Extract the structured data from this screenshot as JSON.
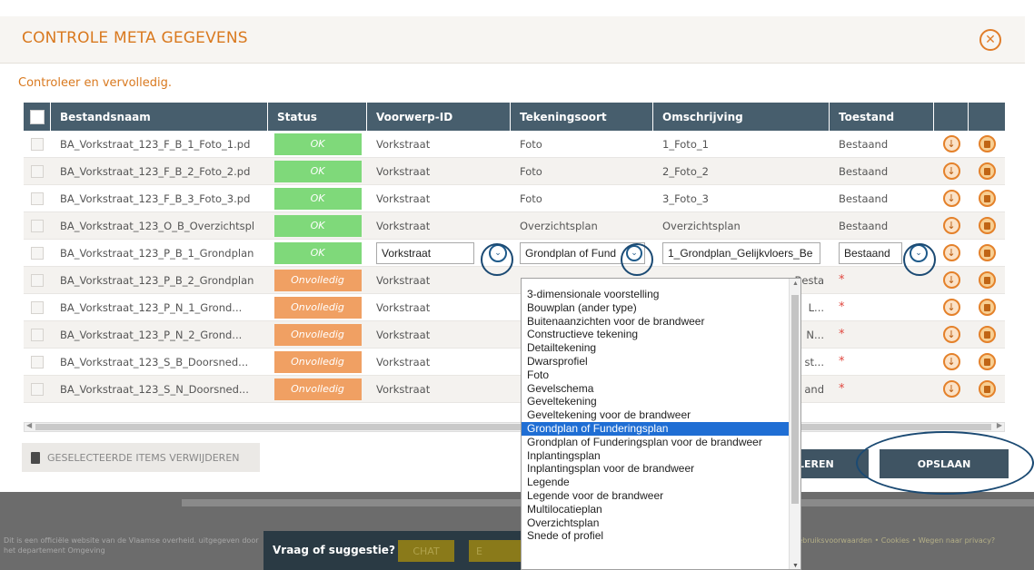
{
  "modal": {
    "title": "CONTROLE META GEGEVENS",
    "close_icon": "close-circle-icon",
    "subtitle": "Controleer en vervolledig."
  },
  "table": {
    "headers": [
      "Bestandsnaam",
      "Status",
      "Voorwerp-ID",
      "Tekeningsoort",
      "Omschrijving",
      "Toestand"
    ],
    "rows": [
      {
        "name": "BA_Vorkstraat_123_F_B_1_Foto_1.pd",
        "status": "OK",
        "vid": "Vorkstraat",
        "teken": "Foto",
        "oms": "1_Foto_1",
        "toe": "Bestaand"
      },
      {
        "name": "BA_Vorkstraat_123_F_B_2_Foto_2.pd",
        "status": "OK",
        "vid": "Vorkstraat",
        "teken": "Foto",
        "oms": "2_Foto_2",
        "toe": "Bestaand"
      },
      {
        "name": "BA_Vorkstraat_123_F_B_3_Foto_3.pd",
        "status": "OK",
        "vid": "Vorkstraat",
        "teken": "Foto",
        "oms": "3_Foto_3",
        "toe": "Bestaand"
      },
      {
        "name": "BA_Vorkstraat_123_O_B_Overzichtspl",
        "status": "OK",
        "vid": "Vorkstraat",
        "teken": "Overzichtsplan",
        "oms": "Overzichtsplan",
        "toe": "Bestaand"
      },
      {
        "name": "BA_Vorkstraat_123_P_B_1_Grondplan",
        "status": "OK",
        "vid": "Vorkstraat",
        "teken": "Grondplan of Fund",
        "oms": "1_Grondplan_Gelijkvloers_Be",
        "toe": "Bestaand"
      },
      {
        "name": "BA_Vorkstraat_123_P_B_2_Grondplan",
        "status": "Onvolledig",
        "vid": "Vorkstraat",
        "teken": "",
        "oms": "Besta",
        "toe": "*"
      },
      {
        "name": "BA_Vorkstraat_123_P_N_1_Grond...",
        "status": "Onvolledig",
        "vid": "Vorkstraat",
        "teken": "",
        "oms": "L...",
        "toe": "*"
      },
      {
        "name": "BA_Vorkstraat_123_P_N_2_Grond...",
        "status": "Onvolledig",
        "vid": "Vorkstraat",
        "teken": "",
        "oms": "N...",
        "toe": "*"
      },
      {
        "name": "BA_Vorkstraat_123_S_B_Doorsned...",
        "status": "Onvolledig",
        "vid": "Vorkstraat",
        "teken": "",
        "oms": "st...",
        "toe": "*"
      },
      {
        "name": "BA_Vorkstraat_123_S_N_Doorsned...",
        "status": "Onvolledig",
        "vid": "Vorkstraat",
        "teken": "",
        "oms": "and",
        "toe": "*"
      }
    ],
    "editing_row_index": 4,
    "row_icons": {
      "download": "download-icon",
      "delete": "trash-icon"
    }
  },
  "dropdown": {
    "options": [
      "3-dimensionale voorstelling",
      "Bouwplan (ander type)",
      "Buitenaanzichten voor de brandweer",
      "Constructieve tekening",
      "Detailtekening",
      "Dwarsprofiel",
      "Foto",
      "Gevelschema",
      "Geveltekening",
      "Geveltekening voor de brandweer",
      "Grondplan of Funderingsplan",
      "Grondplan of Funderingsplan voor de brandweer",
      "Inplantingsplan",
      "Inplantingsplan voor de brandweer",
      "Legende",
      "Legende voor de brandweer",
      "Multilocatieplan",
      "Overzichtsplan",
      "Snede of profiel"
    ],
    "selected": "Grondplan of Funderingsplan"
  },
  "buttons": {
    "delete_selected": "GESELECTEERDE ITEMS VERWIJDEREN",
    "cancel": "LEREN",
    "save": "OPSLAAN"
  },
  "footer": {
    "left_text": "Dit is een officiële website van de Vlaamse overheid. uitgegeven door het departement Omgeving",
    "suggestion_label": "Vraag of suggestie?",
    "chat_label": "CHAT",
    "email_label": "E",
    "right_text": "Gebruiksvoorwaarden • Cookies • Wegen naar privacy?",
    "colors": {
      "accent": "#d9791f",
      "header": "#475e6d",
      "ok": "#7fd97a",
      "warning": "#f0a063",
      "highlight_ring": "#1b4a73"
    }
  }
}
